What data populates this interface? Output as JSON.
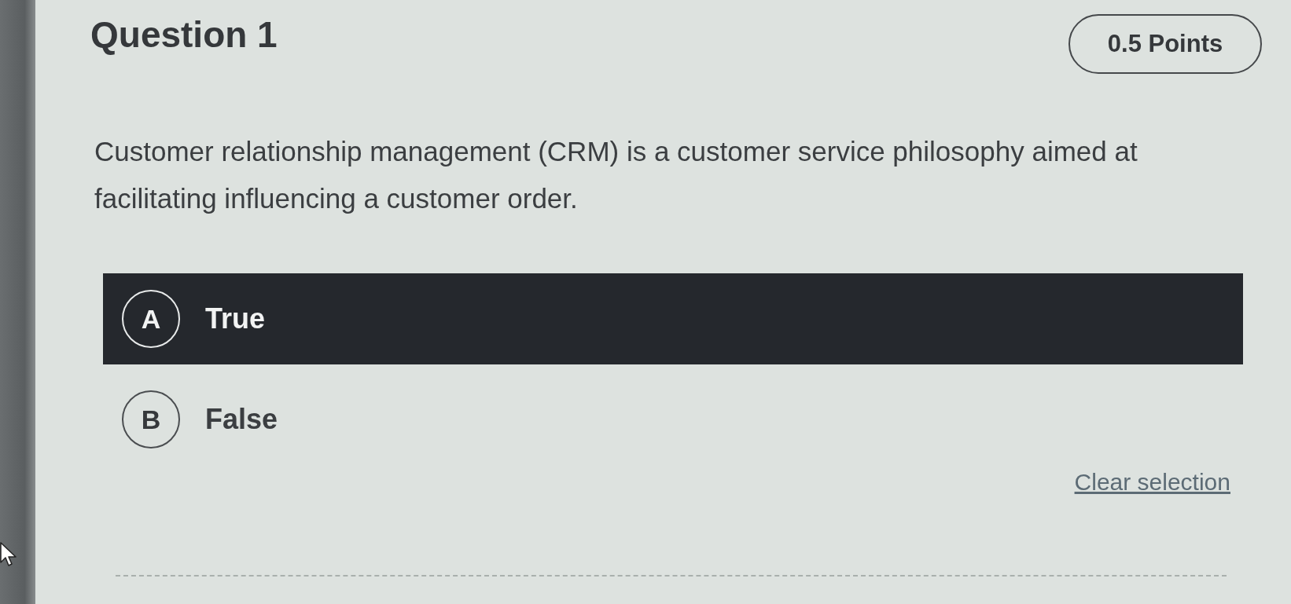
{
  "question": {
    "title": "Question 1",
    "points": "0.5 Points",
    "text": "Customer relationship management (CRM) is a customer service philosophy aimed at facilitating influencing a customer order."
  },
  "options": [
    {
      "letter": "A",
      "label": "True",
      "selected": true
    },
    {
      "letter": "B",
      "label": "False",
      "selected": false
    }
  ],
  "clear_link": "Clear selection"
}
